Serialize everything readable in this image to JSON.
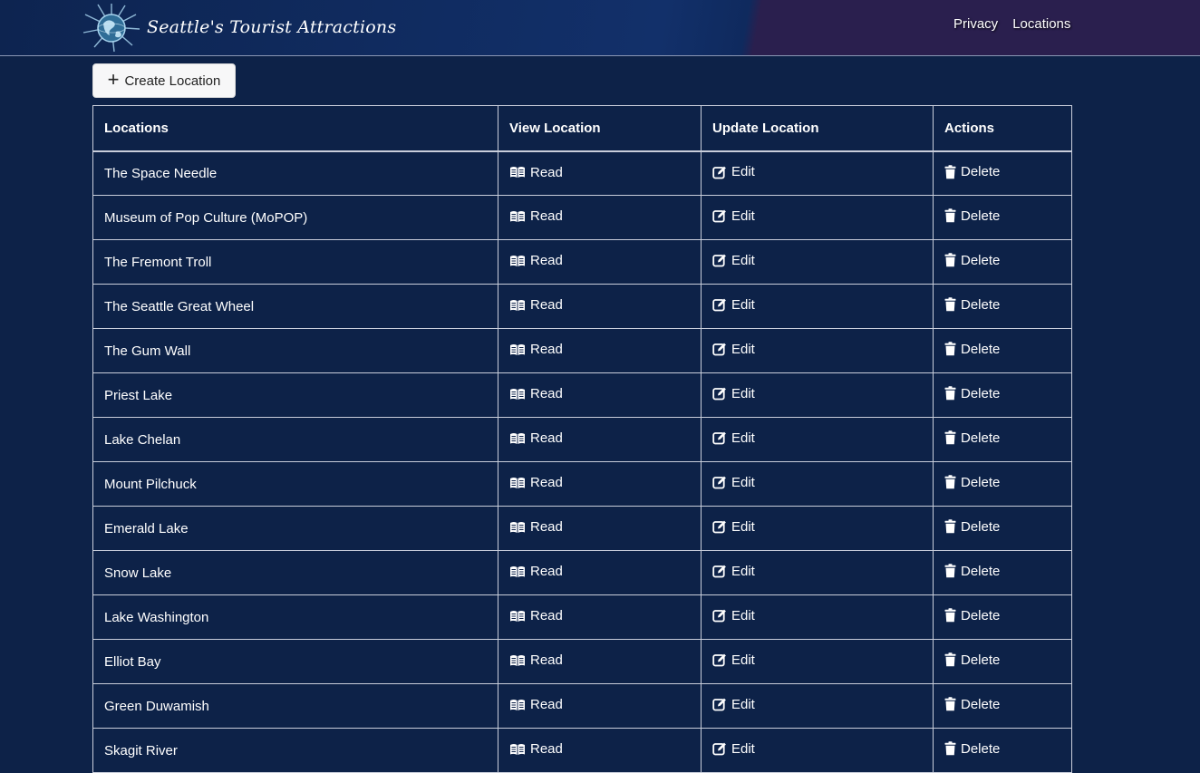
{
  "header": {
    "brand_title": "Seattle's Tourist Attractions",
    "nav": [
      {
        "label": "Privacy"
      },
      {
        "label": "Locations"
      }
    ]
  },
  "toolbar": {
    "create_label": "Create Location",
    "create_icon": "plus-icon"
  },
  "table": {
    "columns": [
      "Locations",
      "View Location",
      "Update Location",
      "Actions"
    ],
    "action_labels": {
      "read": "Read",
      "edit": "Edit",
      "delete": "Delete"
    },
    "action_icons": {
      "read": "book-open-icon",
      "edit": "edit-square-icon",
      "delete": "trash-icon"
    },
    "rows": [
      {
        "name": "The Space Needle"
      },
      {
        "name": "Museum of Pop Culture (MoPOP)"
      },
      {
        "name": "The Fremont Troll"
      },
      {
        "name": "The Seattle Great Wheel"
      },
      {
        "name": "The Gum Wall"
      },
      {
        "name": "Priest Lake"
      },
      {
        "name": "Lake Chelan"
      },
      {
        "name": "Mount Pilchuck"
      },
      {
        "name": "Emerald Lake"
      },
      {
        "name": "Snow Lake"
      },
      {
        "name": "Lake Washington"
      },
      {
        "name": "Elliot Bay"
      },
      {
        "name": "Green Duwamish"
      },
      {
        "name": "Skagit River"
      }
    ]
  },
  "colors": {
    "page_background": "#0d2248",
    "header_left": "#0d2450",
    "header_right": "#2a1f4e",
    "table_border": "#c9cedb",
    "button_background": "#f7f7f8"
  }
}
